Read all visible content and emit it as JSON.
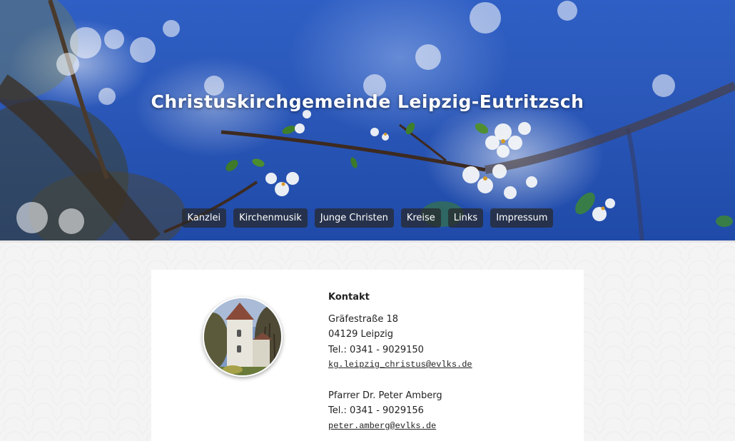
{
  "site": {
    "title": "Christuskirchgemeinde Leipzig-Eutritzsch"
  },
  "nav": {
    "items": [
      {
        "label": "Kanzlei"
      },
      {
        "label": "Kirchenmusik"
      },
      {
        "label": "Junge Christen"
      },
      {
        "label": "Kreise"
      },
      {
        "label": "Links"
      },
      {
        "label": "Impressum"
      }
    ]
  },
  "contact": {
    "heading": "Kontakt",
    "street": "Gräfestraße 18",
    "city": "04129 Leipzig",
    "phone": "Tel.: 0341 - 9029150",
    "email": "kg.leipzig_christus@evlks.de",
    "pastor_name": "Pfarrer Dr. Peter Amberg",
    "pastor_phone": "Tel.: 0341 - 9029156",
    "pastor_email": "peter.amberg@evlks.de"
  },
  "colors": {
    "sky": "#2a57b8",
    "nav_bg": "#282828",
    "text": "#222222"
  },
  "icons": {
    "avatar": "church-photo"
  }
}
